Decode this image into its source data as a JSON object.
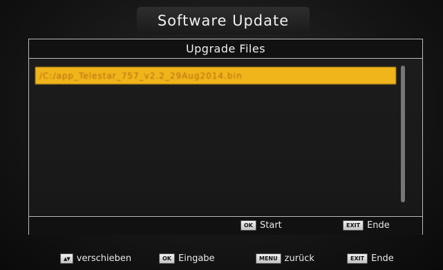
{
  "window": {
    "title": "Software Update"
  },
  "panel": {
    "header": "Upgrade Files",
    "files": [
      {
        "name": "/C:/app_Telestar_757_v2.2_29Aug2014.bin",
        "selected": true
      }
    ],
    "footer": [
      {
        "key": "OK",
        "label": "Start"
      },
      {
        "key": "EXIT",
        "label": "Ende"
      }
    ]
  },
  "help_bar": [
    {
      "key": "▲▼",
      "key_icon": "up-down-arrows-icon",
      "label": "verschieben"
    },
    {
      "key": "OK",
      "label": "Eingabe"
    },
    {
      "key": "MENU",
      "label": "zurück"
    },
    {
      "key": "EXIT",
      "label": "Ende"
    }
  ],
  "colors": {
    "selection": "#f0b51a",
    "background": "#151515",
    "border": "#bdbdbd"
  }
}
